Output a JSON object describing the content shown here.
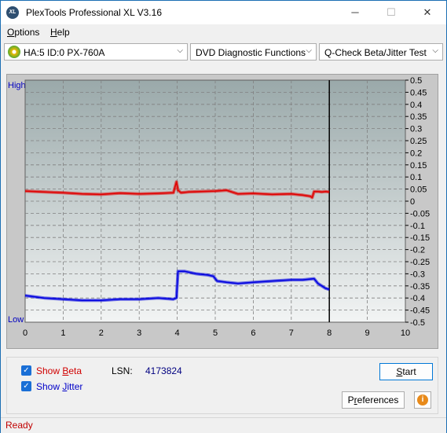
{
  "window": {
    "title": "PlexTools Professional XL V3.16",
    "app_icon_text": "XL",
    "minimize": "─",
    "maximize": "☐",
    "close": "✕"
  },
  "menu": {
    "options": {
      "accel": "O",
      "rest": "ptions"
    },
    "help": {
      "accel": "H",
      "rest": "elp"
    }
  },
  "toolbar": {
    "drive": "HA:5 ID:0  PX-760A",
    "function": "DVD Diagnostic Functions",
    "test": "Q-Check Beta/Jitter Test",
    "arrow": "⌵"
  },
  "chart_labels": {
    "high": "High",
    "low": "Low"
  },
  "chart_data": {
    "type": "line",
    "xlim": [
      0,
      10
    ],
    "ylim": [
      -0.5,
      0.5
    ],
    "x_ticks": [
      "0",
      "1",
      "2",
      "3",
      "4",
      "5",
      "6",
      "7",
      "8",
      "9",
      "10"
    ],
    "y_ticks": [
      "0.5",
      "0.45",
      "0.4",
      "0.35",
      "0.3",
      "0.25",
      "0.2",
      "0.15",
      "0.1",
      "0.05",
      "0",
      "-0.05",
      "-0.1",
      "-0.15",
      "-0.2",
      "-0.25",
      "-0.3",
      "-0.35",
      "-0.4",
      "-0.45",
      "-0.5"
    ],
    "marker_x": 8,
    "colors": {
      "beta": "#e00000",
      "jitter": "#0000e0",
      "bg_top": "#9aa9aa",
      "bg_bottom": "#f2f4f4",
      "grid": "#808080"
    },
    "series": [
      {
        "key": "beta",
        "x": [
          0,
          0.5,
          1,
          1.5,
          2,
          2.5,
          3,
          3.5,
          3.9,
          3.98,
          4.02,
          4.1,
          4.3,
          4.6,
          5,
          5.3,
          5.6,
          6,
          6.5,
          7,
          7.3,
          7.5,
          7.55,
          7.6,
          7.7,
          7.8,
          7.9,
          8.0
        ],
        "y": [
          0.042,
          0.038,
          0.035,
          0.03,
          0.028,
          0.033,
          0.03,
          0.032,
          0.035,
          0.08,
          0.045,
          0.035,
          0.038,
          0.04,
          0.042,
          0.045,
          0.03,
          0.032,
          0.028,
          0.03,
          0.025,
          0.02,
          0.015,
          0.04,
          0.04,
          0.038,
          0.04,
          0.038
        ]
      },
      {
        "key": "jitter",
        "x": [
          0,
          0.5,
          1,
          1.5,
          2,
          2.5,
          3,
          3.5,
          3.9,
          3.98,
          4.02,
          4.2,
          4.5,
          4.8,
          4.95,
          5.05,
          5.3,
          5.6,
          6,
          6.5,
          7,
          7.3,
          7.6,
          7.7,
          7.8,
          7.9,
          8.0
        ],
        "y": [
          -0.39,
          -0.4,
          -0.405,
          -0.41,
          -0.41,
          -0.405,
          -0.405,
          -0.4,
          -0.405,
          -0.4,
          -0.29,
          -0.29,
          -0.3,
          -0.305,
          -0.31,
          -0.33,
          -0.335,
          -0.34,
          -0.335,
          -0.33,
          -0.325,
          -0.325,
          -0.32,
          -0.34,
          -0.35,
          -0.36,
          -0.365
        ]
      }
    ]
  },
  "controls": {
    "show_beta": {
      "accel": "B",
      "pre": "Show ",
      "rest": "eta"
    },
    "show_jitter": {
      "accel": "J",
      "pre": "Show ",
      "rest": "itter"
    },
    "lsn_label": "LSN:",
    "lsn_value": "4173824",
    "start": {
      "accel": "S",
      "rest": "tart"
    },
    "preferences": {
      "pre": "P",
      "accel": "r",
      "rest": "eferences"
    },
    "info": "i",
    "check": "✓"
  },
  "status": "Ready"
}
